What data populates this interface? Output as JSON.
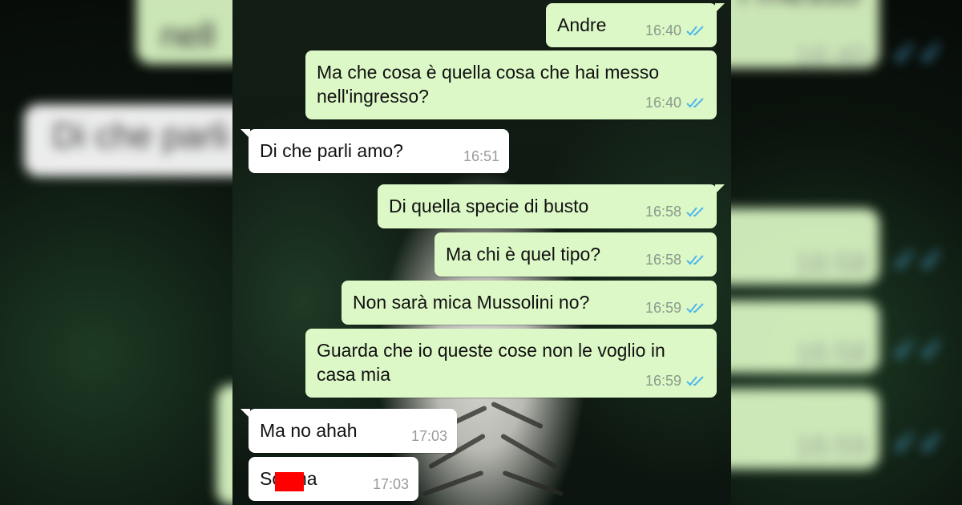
{
  "messages": [
    {
      "text": "Andre",
      "time": "16:40",
      "dir": "out",
      "status": "read"
    },
    {
      "text": "Ma che cosa è quella cosa che hai messo\nnell'ingresso?",
      "time": "16:40",
      "dir": "out",
      "status": "read"
    },
    {
      "text": "Di che parli amo?",
      "time": "16:51",
      "dir": "in"
    },
    {
      "text": "Di quella specie di busto",
      "time": "16:58",
      "dir": "out",
      "status": "read"
    },
    {
      "text": "Ma chi è quel tipo?",
      "time": "16:58",
      "dir": "out",
      "status": "read"
    },
    {
      "text": "Non sarà mica Mussolini no?",
      "time": "16:59",
      "dir": "out",
      "status": "read"
    },
    {
      "text": "Guarda che io queste cose non le voglio in\ncasa mia",
      "time": "16:59",
      "dir": "out",
      "status": "read"
    },
    {
      "text": "Ma no ahah",
      "time": "17:03",
      "dir": "in"
    },
    {
      "text": "Scema",
      "time": "17:03",
      "dir": "in"
    }
  ],
  "blurred_left": {
    "top_text": "nell",
    "top_time": "16:40",
    "middle_text": "Di che parli"
  },
  "blurred_right": {
    "top_text": "i messo",
    "times": [
      "16:40",
      "16:58",
      "16:58",
      "16:59"
    ]
  },
  "colors": {
    "outgoing_bubble": "#dcf8c6",
    "incoming_bubble": "#ffffff",
    "read_check": "#4fb6ec",
    "redaction": "#ff0000"
  },
  "icons": {
    "read_receipt": "double-check-icon"
  }
}
